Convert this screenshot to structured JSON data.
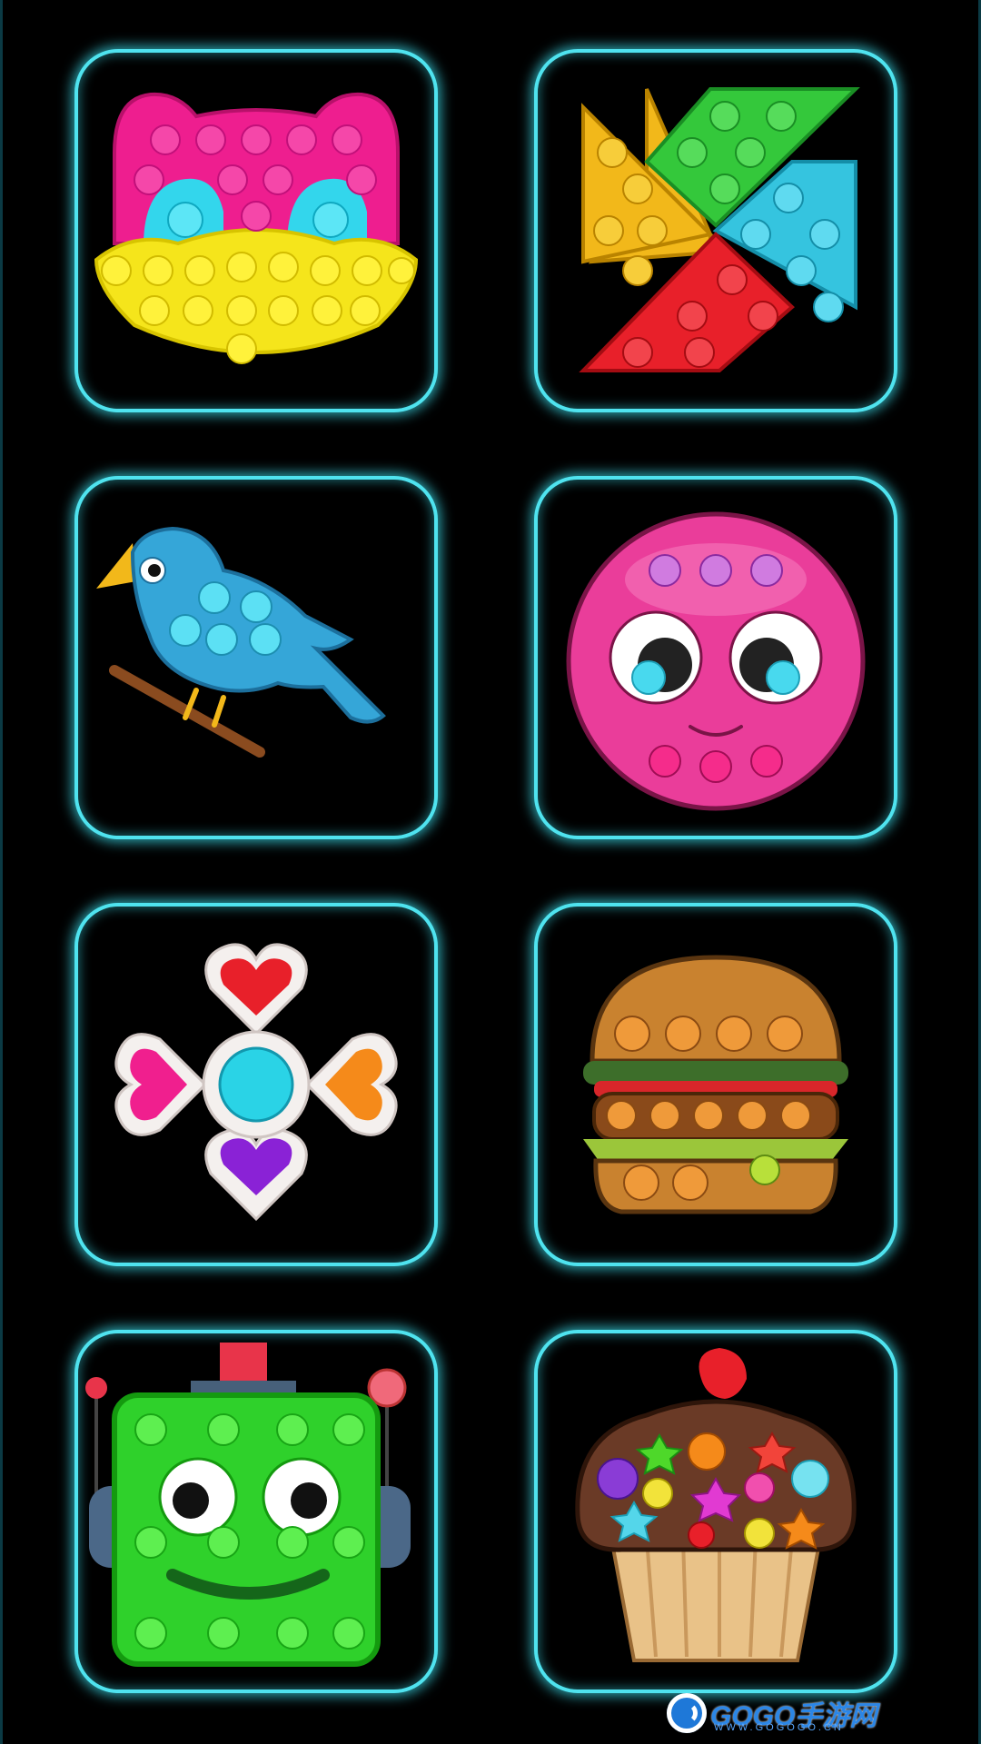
{
  "levels": [
    {
      "id": "owl",
      "icon": "owl-pop-it-icon"
    },
    {
      "id": "pinwheel",
      "icon": "pinwheel-pop-it-icon"
    },
    {
      "id": "bird",
      "icon": "bird-pop-it-icon"
    },
    {
      "id": "pink-face",
      "icon": "smiley-ball-pop-it-icon"
    },
    {
      "id": "hearts",
      "icon": "heart-fidget-pop-it-icon"
    },
    {
      "id": "burger",
      "icon": "burger-pop-it-icon"
    },
    {
      "id": "robot",
      "icon": "robot-pop-it-icon"
    },
    {
      "id": "cupcake",
      "icon": "cupcake-pop-it-icon"
    }
  ],
  "colors": {
    "tile_border": "#4fe3ef",
    "background": "#000000"
  },
  "watermark": {
    "brand": "GOGO手游网",
    "url": "WWW.GOGOGO.CN"
  }
}
